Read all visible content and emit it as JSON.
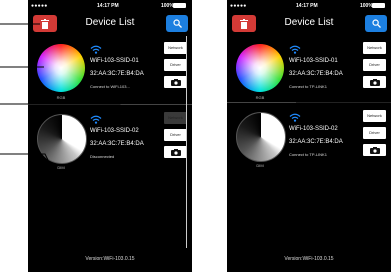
{
  "status": {
    "carrier": "●●●●● ",
    "time": "14:17 PM",
    "battery": "100%"
  },
  "nav": {
    "title": "Device List"
  },
  "buttons": {
    "network": "Network",
    "driver": "Driver"
  },
  "screen_left": {
    "devices": [
      {
        "name": "WiFi-103-SSID-01",
        "mac": "32:AA:3C:7E:B4:DA",
        "status": "Connect to WiFi-103...",
        "mode": "RGB"
      },
      {
        "name": "WiFi-103-SSID-02",
        "mac": "32:AA:3C:7E:B4:DA",
        "status": "Disconnected",
        "mode": "DIM"
      }
    ]
  },
  "screen_right": {
    "devices": [
      {
        "name": "WiFi-103-SSID-01",
        "mac": "32:AA:3C:7E:B4:DA",
        "status": "Connect to TP-LINK1",
        "mode": "RGB"
      },
      {
        "name": "WiFi-103-SSID-02",
        "mac": "32:AA:3C:7E:B4:DA",
        "status": "Connect to TP-LINK1",
        "mode": "DIM"
      }
    ]
  },
  "footer": {
    "version": "Version:WiFi-103.0.15"
  },
  "colors": {
    "delete": "#d33a36",
    "search": "#1c7fe0",
    "wifi": "#1f8bff",
    "background": "#000000"
  }
}
